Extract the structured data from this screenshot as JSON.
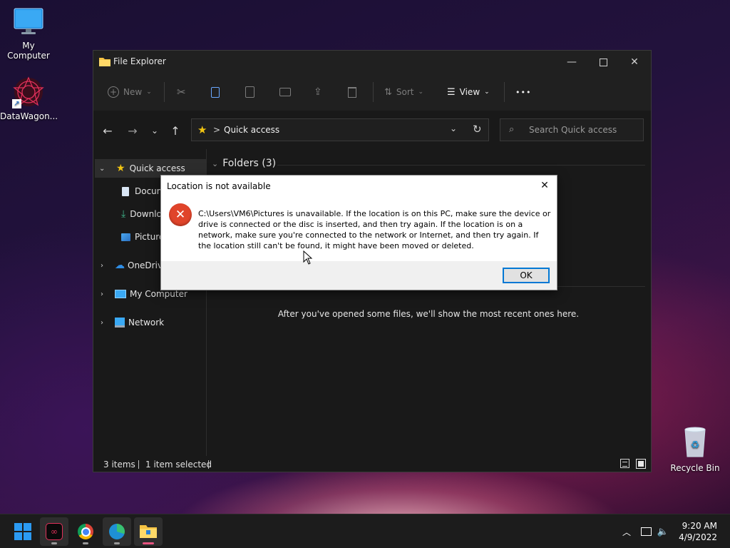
{
  "desktop": {
    "icons": [
      {
        "label": "My Computer"
      },
      {
        "label": "DataWagon..."
      },
      {
        "label": "Recycle Bin"
      }
    ]
  },
  "explorer": {
    "title": "File Explorer",
    "toolbar": {
      "new_label": "New",
      "sort_label": "Sort",
      "view_label": "View",
      "more_label": "•••"
    },
    "address": {
      "path": "Quick access",
      "separator": ">"
    },
    "search": {
      "placeholder": "Search Quick access"
    },
    "sidebar": {
      "items": [
        {
          "label": "Quick access"
        },
        {
          "label": "Documents"
        },
        {
          "label": "Downloads"
        },
        {
          "label": "Pictures"
        },
        {
          "label": "OneDrive"
        },
        {
          "label": "My Computer"
        },
        {
          "label": "Network"
        }
      ]
    },
    "content": {
      "folders_header": "Folders (3)",
      "recent_empty_message": "After you've opened some files, we'll show the most recent ones here."
    },
    "status": {
      "item_count": "3 items",
      "selection": "1 item selected"
    }
  },
  "dialog": {
    "title": "Location is not available",
    "message": "C:\\Users\\VM6\\Pictures is unavailable. If the location is on this PC, make sure the device or drive is connected or the disc is inserted, and then try again. If the location is on a network, make sure you're connected to the network or Internet, and then try again. If the location still can't be found, it might have been moved or deleted.",
    "ok_label": "OK"
  },
  "taskbar": {
    "clock_time": "9:20 AM",
    "clock_date": "4/9/2022"
  },
  "colors": {
    "accent": "#0078d4",
    "error_icon": "#e0442a",
    "folder_yellow": "#f5c242",
    "star_yellow": "#f2c511"
  }
}
